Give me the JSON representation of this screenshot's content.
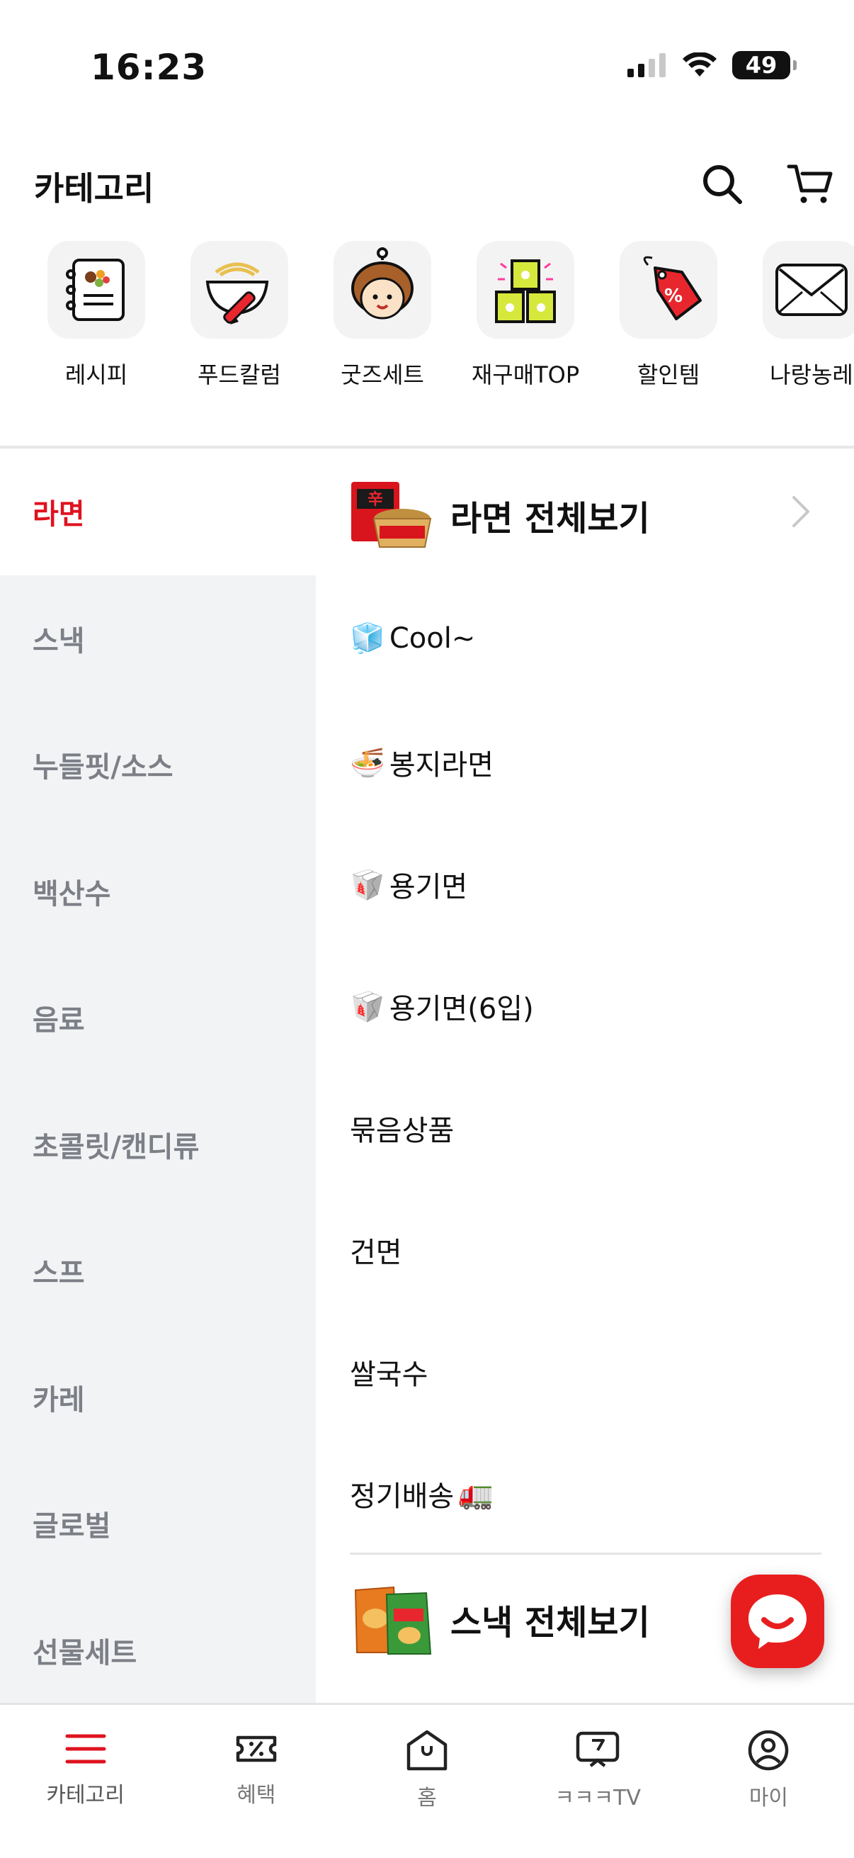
{
  "status_bar": {
    "time": "16:23",
    "battery": "49"
  },
  "header": {
    "title": "카테고리",
    "search_icon": "search-icon",
    "cart_icon": "cart-icon"
  },
  "quick_categories": [
    {
      "label": "레시피",
      "icon": "recipe-notebook-icon"
    },
    {
      "label": "푸드칼럼",
      "icon": "food-column-bowl-icon"
    },
    {
      "label": "굿즈세트",
      "icon": "goods-character-icon"
    },
    {
      "label": "재구매TOP",
      "icon": "repurchase-top-icon"
    },
    {
      "label": "할인템",
      "icon": "discount-tag-icon"
    },
    {
      "label": "나랑농레",
      "icon": "envelope-icon"
    }
  ],
  "left_categories": [
    {
      "label": "라면",
      "active": true
    },
    {
      "label": "스낵"
    },
    {
      "label": "누들핏/소스"
    },
    {
      "label": "백산수"
    },
    {
      "label": "음료"
    },
    {
      "label": "초콜릿/캔디류"
    },
    {
      "label": "스프"
    },
    {
      "label": "카레"
    },
    {
      "label": "글로벌"
    },
    {
      "label": "선물세트"
    }
  ],
  "right_panel": {
    "section_title": "라면 전체보기",
    "items": [
      {
        "label": "Cool~",
        "emoji": "🧊"
      },
      {
        "label": "봉지라면",
        "emoji": "🍜"
      },
      {
        "label": "용기면",
        "emoji": "🥡"
      },
      {
        "label": "용기면(6입)",
        "emoji": "🥡"
      },
      {
        "label": "묶음상품",
        "emoji": ""
      },
      {
        "label": "건면",
        "emoji": ""
      },
      {
        "label": "쌀국수",
        "emoji": ""
      },
      {
        "label": "정기배송",
        "emoji": "🚛"
      }
    ],
    "next_section_title": "스낵 전체보기"
  },
  "bottom_nav": [
    {
      "label": "카테고리",
      "icon": "menu-icon",
      "active": true
    },
    {
      "label": "혜택",
      "icon": "coupon-icon"
    },
    {
      "label": "홈",
      "icon": "home-bag-icon"
    },
    {
      "label": "ㅋㅋㅋTV",
      "icon": "tv-icon"
    },
    {
      "label": "마이",
      "icon": "profile-icon"
    }
  ],
  "colors": {
    "accent": "#e0121f",
    "sidebar_bg": "#f2f3f5",
    "inactive_text": "#7d7f87"
  }
}
